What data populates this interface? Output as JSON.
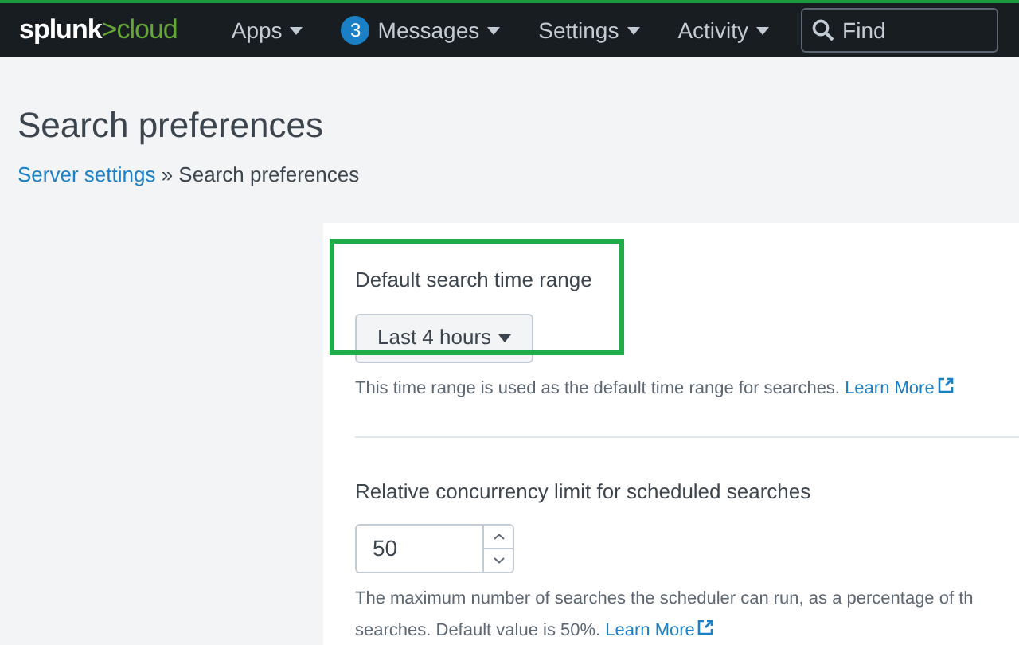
{
  "navbar": {
    "logo_main": "splunk",
    "logo_accent": ">cloud",
    "menus": [
      {
        "label": "Apps"
      },
      {
        "label": "Messages",
        "badge": "3"
      },
      {
        "label": "Settings"
      },
      {
        "label": "Activity"
      }
    ],
    "search": {
      "placeholder": "Find"
    }
  },
  "page": {
    "title": "Search preferences",
    "breadcrumb": [
      {
        "label": "Server settings",
        "link": true
      },
      {
        "label": "Search preferences",
        "link": false
      }
    ],
    "separator": "»"
  },
  "settings": [
    {
      "kind": "dropdown",
      "label": "Default search time range",
      "value": "Last 4 hours",
      "highlighted": true,
      "help_lines": [
        "This time range is used as the default time range for searches."
      ],
      "link": "Learn More"
    },
    {
      "kind": "number",
      "label": "Relative concurrency limit for scheduled searches",
      "value": "50",
      "highlighted": false,
      "help_lines": [
        "The maximum number of searches the scheduler can run, as a percentage of th",
        "searches. Default value is 50%."
      ],
      "link": "Learn More"
    }
  ]
}
